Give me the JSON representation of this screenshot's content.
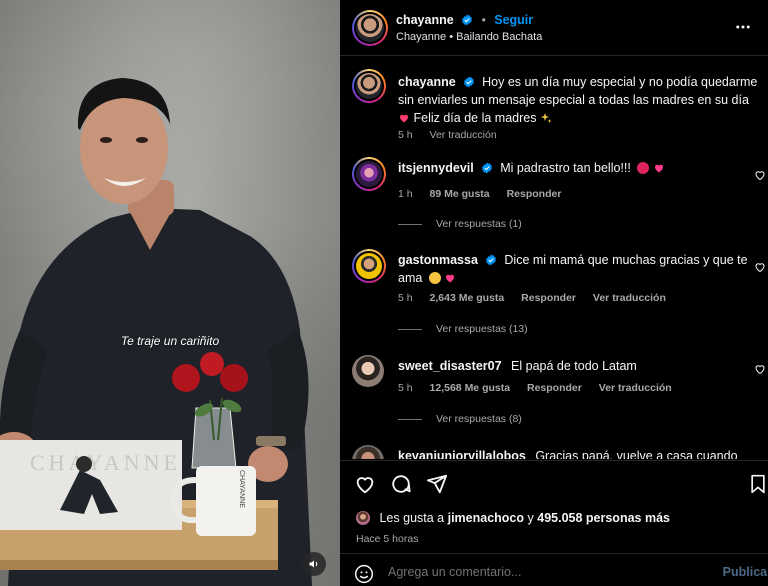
{
  "video": {
    "caption": "Te traje un cariñito",
    "album_cover_text": "CHAYANNE",
    "mug_text": "CHAYANNE"
  },
  "header": {
    "username": "chayanne",
    "dot": "•",
    "follow_label": "Seguir",
    "subtitle": "Chayanne • Bailando Bachata"
  },
  "caption_post": {
    "username": "chayanne",
    "text": "Hoy es un día muy especial y no podía quedarme sin enviarles un mensaje especial a todas las madres en su día",
    "text2": "Feliz día de la madres",
    "time": "5 h",
    "translate": "Ver traducción"
  },
  "comments": [
    {
      "username": "itsjennydevil",
      "text": "Mi padrastro tan bello!!!",
      "time": "1 h",
      "likes": "89 Me gusta",
      "reply": "Responder",
      "translate": "",
      "view_replies": "Ver respuestas (1)"
    },
    {
      "username": "gastonmassa",
      "text": "Dice mi mamá que muchas gracias y que te ama",
      "time": "5 h",
      "likes": "2,643 Me gusta",
      "reply": "Responder",
      "translate": "Ver traducción",
      "view_replies": "Ver respuestas (13)"
    },
    {
      "username": "sweet_disaster07",
      "text": "El papá de todo Latam",
      "time": "5 h",
      "likes": "12,568 Me gusta",
      "reply": "Responder",
      "translate": "Ver traducción",
      "view_replies": "Ver respuestas (8)"
    },
    {
      "username": "kevanjuniorvillalobos",
      "text": "Gracias papá, vuelve a casa cuando"
    }
  ],
  "actions": {
    "likes_prefix": "Les gusta a",
    "liked_by": "jimenachoco",
    "likes_mid": "y",
    "likes_count": "495.058 personas más",
    "time_ago": "Hace 5 horas"
  },
  "comment_box": {
    "placeholder": "Agrega un comentario...",
    "publish_label": "Publicar"
  },
  "icons": {
    "more": "more-horizontal-icon",
    "like": "heart-icon",
    "comment": "comment-icon",
    "share": "share-icon",
    "save": "bookmark-icon",
    "emoji": "emoji-icon",
    "sound": "speaker-icon",
    "verified": "verified-badge-icon"
  },
  "colors": {
    "follow": "#0095f6",
    "verified": "#0095f6",
    "background": "#000000",
    "muted_text": "#a8a8a8"
  }
}
